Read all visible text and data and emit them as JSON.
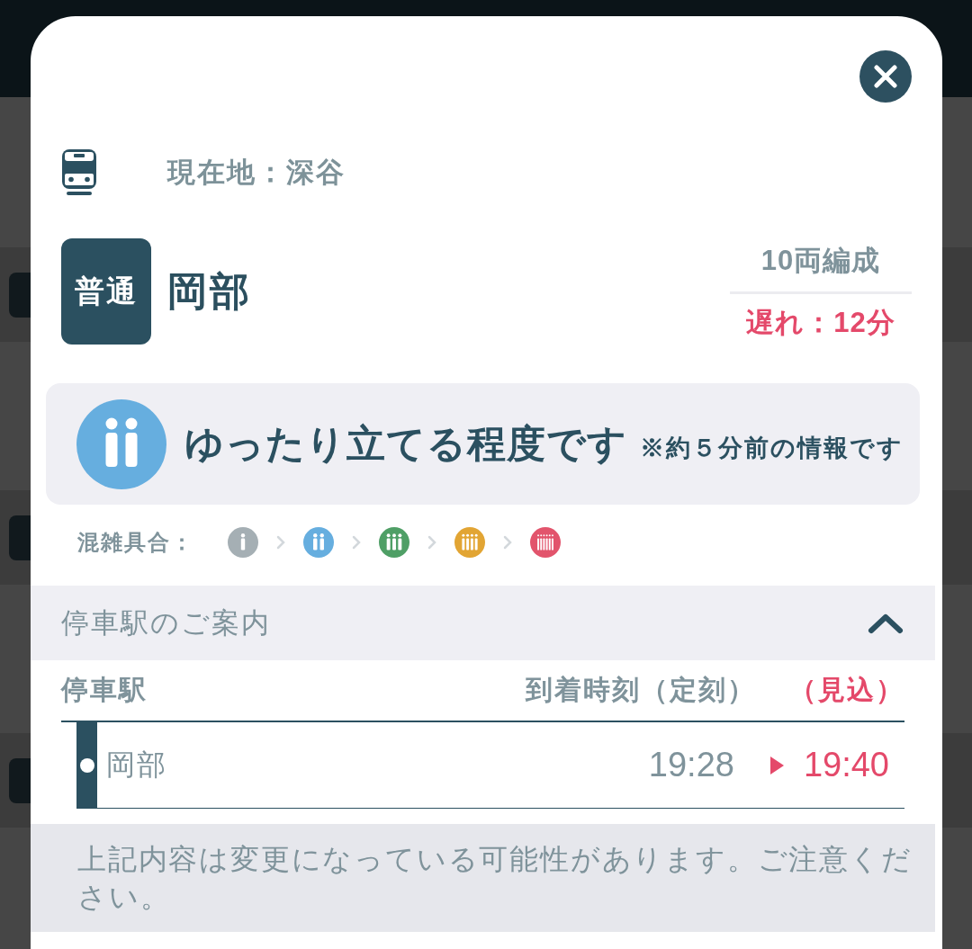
{
  "location": "現在地：深谷",
  "train": {
    "type": "普通",
    "destination": "岡部",
    "cars": "10両編成",
    "delay": "遅れ：12分"
  },
  "crowding": {
    "kind": "standing",
    "color": "#66aedf",
    "status": "ゆったり立てる程度です",
    "note": "※約５分前の情報です",
    "legend_label": "混雑具合：",
    "legend": [
      {
        "kind": "seated",
        "color": "#a5afb4"
      },
      {
        "kind": "standing",
        "color": "#66aedf"
      },
      {
        "kind": "busy",
        "color": "#4f9f66"
      },
      {
        "kind": "crowded",
        "color": "#e2a534"
      },
      {
        "kind": "packed",
        "color": "#e2546c"
      }
    ]
  },
  "stops": {
    "title": "停車駅のご案内",
    "expanded": true,
    "columns": [
      "停車駅",
      "到着時刻（定刻）",
      "（見込）"
    ],
    "rows": [
      {
        "station": "岡部",
        "scheduled": "19:28",
        "expected": "19:40"
      }
    ]
  },
  "notice": "上記内容は変更になっている可能性があります。ご注意ください。"
}
